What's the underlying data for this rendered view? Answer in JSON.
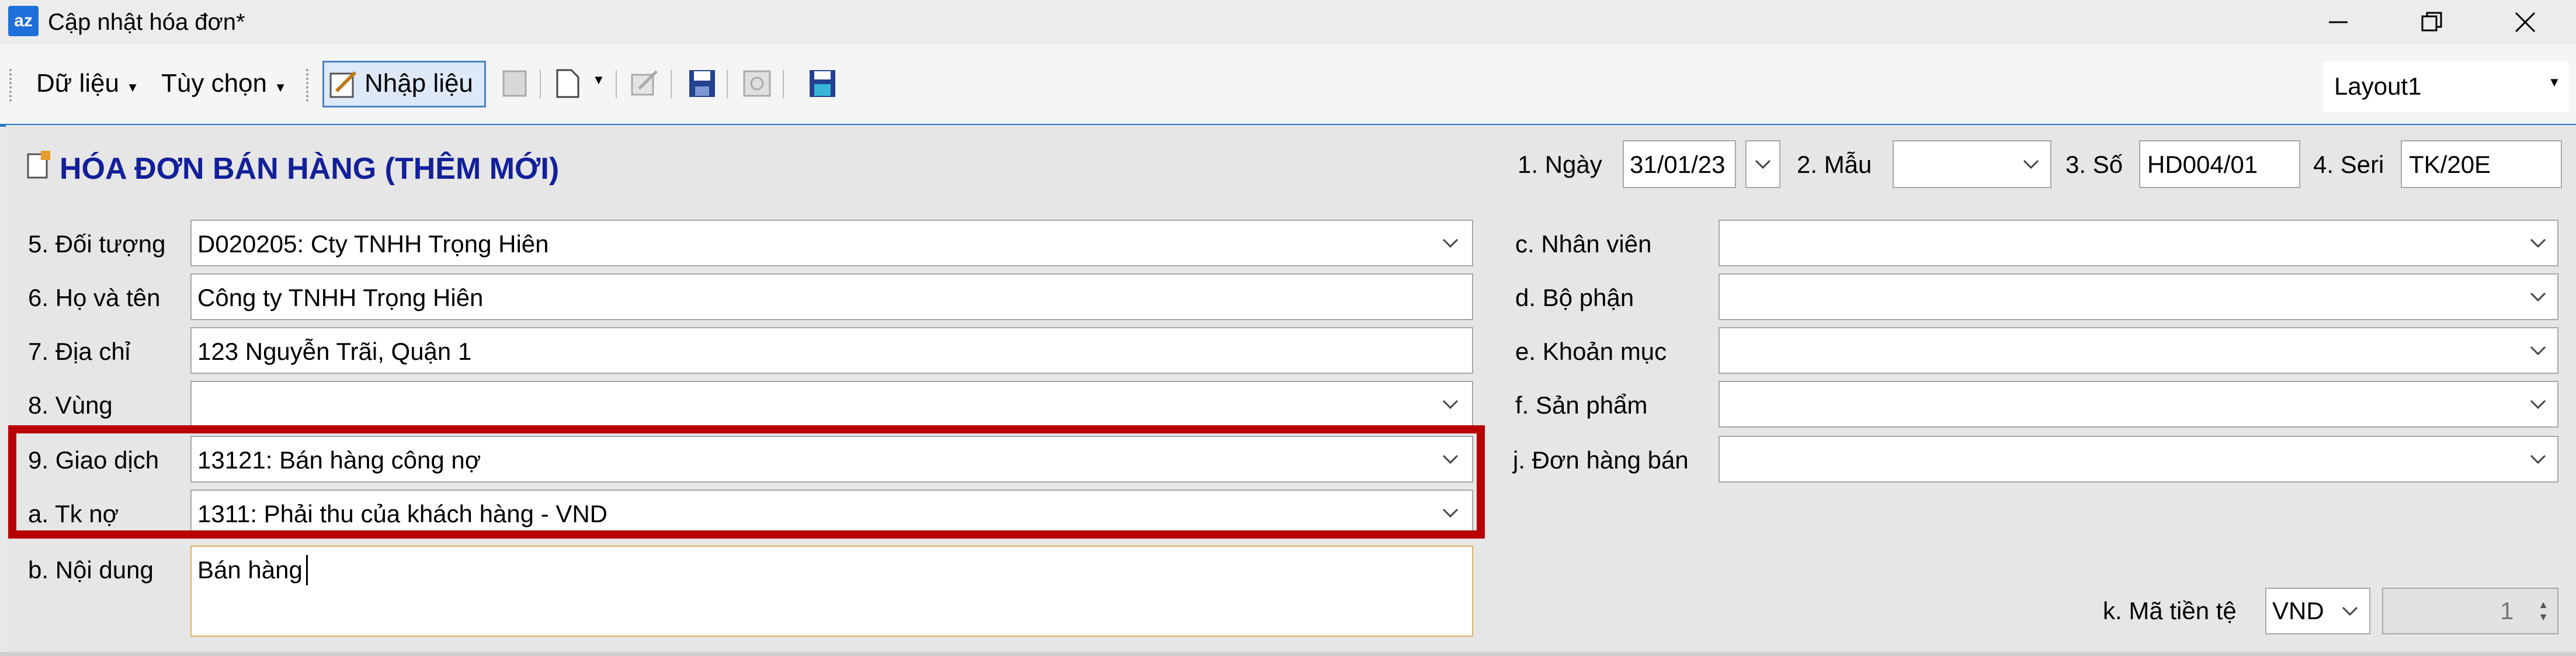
{
  "window": {
    "app_icon_text": "az",
    "title": "Cập nhật hóa đơn*",
    "controls": [
      "minimize",
      "restore",
      "close"
    ]
  },
  "toolbar": {
    "du_lieu": "Dữ liệu",
    "tuy_chon": "Tùy chọn",
    "nhap_lieu": "Nhập liệu",
    "icons": [
      "refresh-icon",
      "new-document-icon",
      "edit-icon",
      "save-icon",
      "disabled-action-icon",
      "save-as-icon"
    ],
    "layout_value": "Layout1"
  },
  "form": {
    "title": "HÓA ĐƠN BÁN HÀNG (THÊM MỚI)",
    "header_fields": {
      "ngay_label": "1. Ngày",
      "ngay_value": "31/01/23",
      "mau_label": "2. Mẫu",
      "mau_value": "",
      "so_label": "3. Số",
      "so_value": "HD004/01",
      "seri_label": "4. Seri",
      "seri_value": "TK/20E"
    },
    "left": {
      "doi_tuong_label": "5. Đối tượng",
      "doi_tuong_value": "D020205: Cty TNHH Trọng Hiên",
      "ho_ten_label": "6. Họ và tên",
      "ho_ten_value": "Công ty TNHH Trọng Hiên",
      "dia_chi_label": "7. Địa chỉ",
      "dia_chi_value": "123 Nguyễn Trãi, Quận 1",
      "vung_label": "8. Vùng",
      "vung_value": "",
      "giao_dich_label": "9. Giao dịch",
      "giao_dich_value": "13121: Bán hàng công nợ",
      "tk_no_label": "a. Tk nợ",
      "tk_no_value": "1311: Phải thu của khách hàng - VND",
      "noi_dung_label": "b. Nội dung",
      "noi_dung_value": "Bán hàng"
    },
    "right": {
      "nhan_vien_label": "c. Nhân viên",
      "nhan_vien_value": "",
      "bo_phan_label": "d. Bộ phận",
      "bo_phan_value": "",
      "khoan_muc_label": "e. Khoản mục",
      "khoan_muc_value": "",
      "san_pham_label": "f. Sản phẩm",
      "san_pham_value": "",
      "don_hang_label": "j. Đơn hàng bán",
      "don_hang_value": ""
    },
    "currency": {
      "label": "k. Mã tiền tệ",
      "value": "VND",
      "rate": "1"
    }
  },
  "colors": {
    "title_blue": "#12209a",
    "highlight_red": "#b80000",
    "toolbar_accent": "#2b78c2"
  }
}
